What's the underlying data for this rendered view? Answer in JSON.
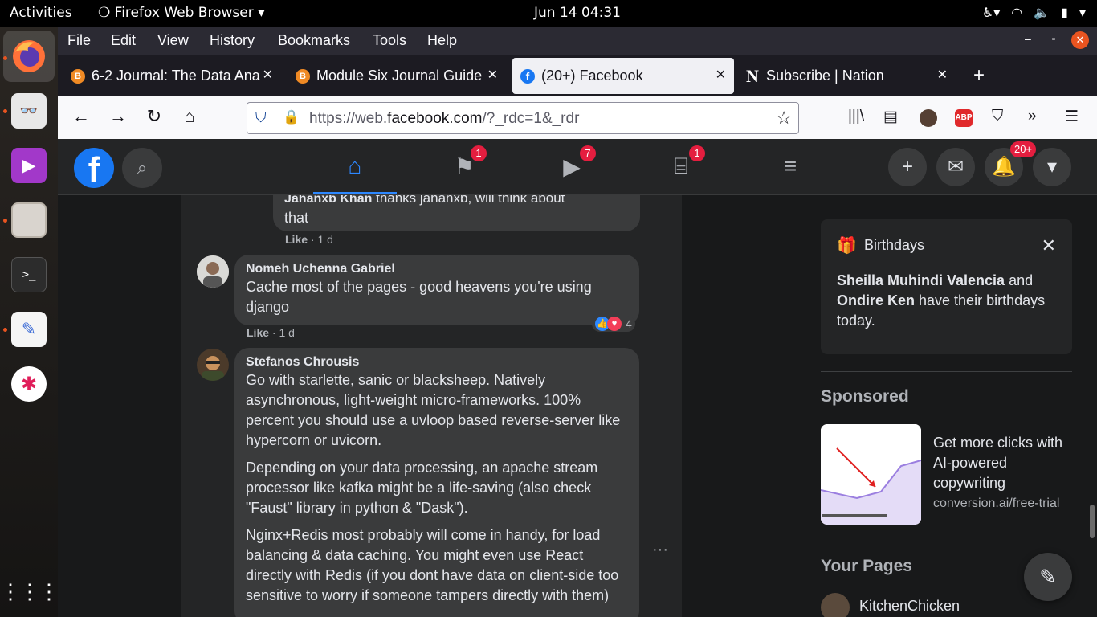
{
  "system": {
    "activities": "Activities",
    "app_name": "Firefox Web Browser",
    "clock": "Jun 14  04:31"
  },
  "menubar": {
    "items": [
      "File",
      "Edit",
      "View",
      "History",
      "Bookmarks",
      "Tools",
      "Help"
    ]
  },
  "tabs": [
    {
      "title": "6-2 Journal: The Data Ana",
      "favicon": "brightspace-icon"
    },
    {
      "title": "Module Six Journal Guide",
      "favicon": "brightspace-icon"
    },
    {
      "title": "(20+) Facebook",
      "favicon": "facebook-icon"
    },
    {
      "title": "Subscribe | Nation",
      "favicon": "nation-icon"
    }
  ],
  "urlbar": {
    "prefix": "https://web.",
    "domain": "facebook.com",
    "path": "/?_rdc=1&_rdr"
  },
  "toolbar": {
    "abp_label": "ABP"
  },
  "fb_header": {
    "logo": "f",
    "badges": {
      "pages": "1",
      "watch": "7",
      "marketplace": "1",
      "notifications": "20+"
    }
  },
  "comments": {
    "partial": {
      "name": "Jahanxb Khan",
      "text_tail": "thanks jahanxb, will think about",
      "text_end": "that",
      "like": "Like",
      "time": "1 d"
    },
    "c1": {
      "name": "Nomeh Uchenna Gabriel",
      "text": "Cache most of the pages - good heavens you're using django",
      "like": "Like",
      "time": "1 d",
      "reactions": "4"
    },
    "c2": {
      "name": "Stefanos Chrousis",
      "p1": "Go with starlette, sanic or blacksheep. Natively asynchronous, light-weight micro-frameworks. 100% percent you should use a uvloop based reverse-server like hypercorn or uvicorn.",
      "p2": "Depending on your data processing, an apache stream processor like kafka might be a life-saving (also check \"Faust\" library in python & \"Dask\").",
      "p3": "Nginx+Redis most probably will come in handy, for load balancing & data caching. You might even use React directly with Redis (if you dont have data on client-side too sensitive to worry if someone tampers directly with them)"
    },
    "more": "···"
  },
  "sidebar": {
    "birthdays": {
      "title": "Birthdays",
      "name1": "Sheilla Muhindi Valencia",
      "and": " and ",
      "name2": "Ondire Ken",
      "rest": " have their birthdays today."
    },
    "sponsored": {
      "title": "Sponsored",
      "ad_text": "Get more clicks with AI-powered copywriting",
      "ad_url": "conversion.ai/free-trial"
    },
    "your_pages": {
      "title": "Your Pages",
      "page": "KitchenChicken"
    }
  },
  "colors": {
    "fb_blue": "#1877f2",
    "badge_red": "#e41e3f",
    "ubuntu_orange": "#e95420"
  }
}
